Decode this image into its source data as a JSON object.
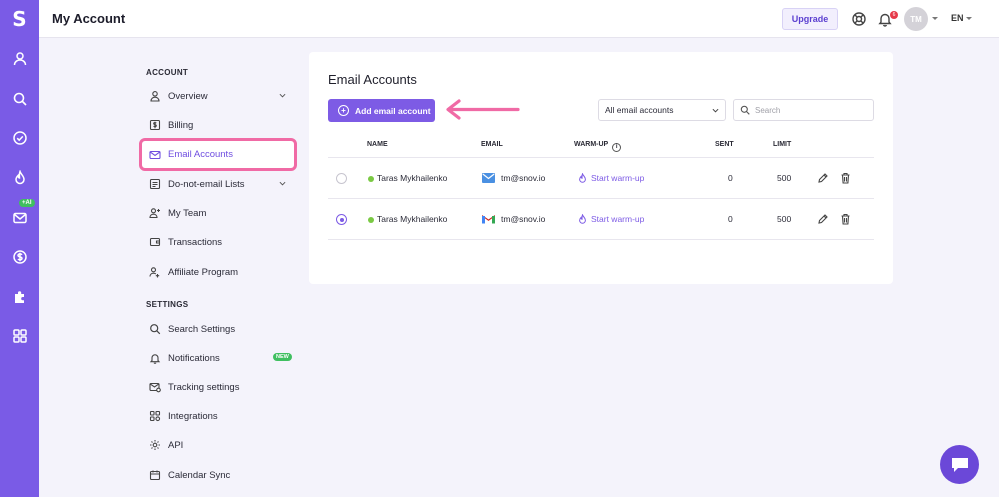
{
  "rail": {
    "logo": "S",
    "items": [
      "user-icon",
      "search-icon",
      "check-circle-icon",
      "flame-icon",
      "mail-icon",
      "dollar-icon",
      "puzzle-icon",
      "apps-icon"
    ],
    "ai_badge": "+AI",
    "bg_color": "#7a5be6"
  },
  "header": {
    "title": "My Account",
    "upgrade_label": "Upgrade",
    "notification_count": "6",
    "avatar_initials": "TM",
    "language": "EN"
  },
  "sidebar": {
    "account_title": "ACCOUNT",
    "account_items": [
      {
        "label": "Overview",
        "icon": "user-icon",
        "expandable": true
      },
      {
        "label": "Billing",
        "icon": "billing-icon"
      },
      {
        "label": "Email Accounts",
        "icon": "mail-icon",
        "active": true
      },
      {
        "label": "Do-not-email Lists",
        "icon": "list-icon",
        "expandable": true
      },
      {
        "label": "My Team",
        "icon": "team-icon"
      },
      {
        "label": "Transactions",
        "icon": "wallet-icon"
      },
      {
        "label": "Affiliate Program",
        "icon": "affiliate-icon"
      }
    ],
    "settings_title": "SETTINGS",
    "settings_items": [
      {
        "label": "Search Settings",
        "icon": "search-icon"
      },
      {
        "label": "Notifications",
        "icon": "bell-icon",
        "badge": "NEW"
      },
      {
        "label": "Tracking settings",
        "icon": "tracking-icon"
      },
      {
        "label": "Integrations",
        "icon": "integrations-icon"
      },
      {
        "label": "API",
        "icon": "api-gear-icon"
      },
      {
        "label": "Calendar Sync",
        "icon": "calendar-icon"
      }
    ]
  },
  "main": {
    "title": "Email Accounts",
    "add_button_label": "Add email account",
    "filter_value": "All email accounts",
    "search_placeholder": "Search",
    "columns": [
      "NAME",
      "EMAIL",
      "WARM-UP",
      "SENT",
      "LIMIT"
    ],
    "rows": [
      {
        "selected": false,
        "name": "Taras Mykhailenko",
        "email": "tm@snov.io",
        "provider": "mail-provider-icon",
        "warmup": "Start warm-up",
        "sent": "0",
        "limit": "500"
      },
      {
        "selected": true,
        "name": "Taras Mykhailenko",
        "email": "tm@snov.io",
        "provider": "gmail-icon",
        "warmup": "Start warm-up",
        "sent": "0",
        "limit": "500"
      }
    ]
  },
  "colors": {
    "accent": "#7d5be5",
    "highlight": "#f06aa5",
    "status_active": "#7ac943",
    "new_badge": "#3fbf60"
  }
}
